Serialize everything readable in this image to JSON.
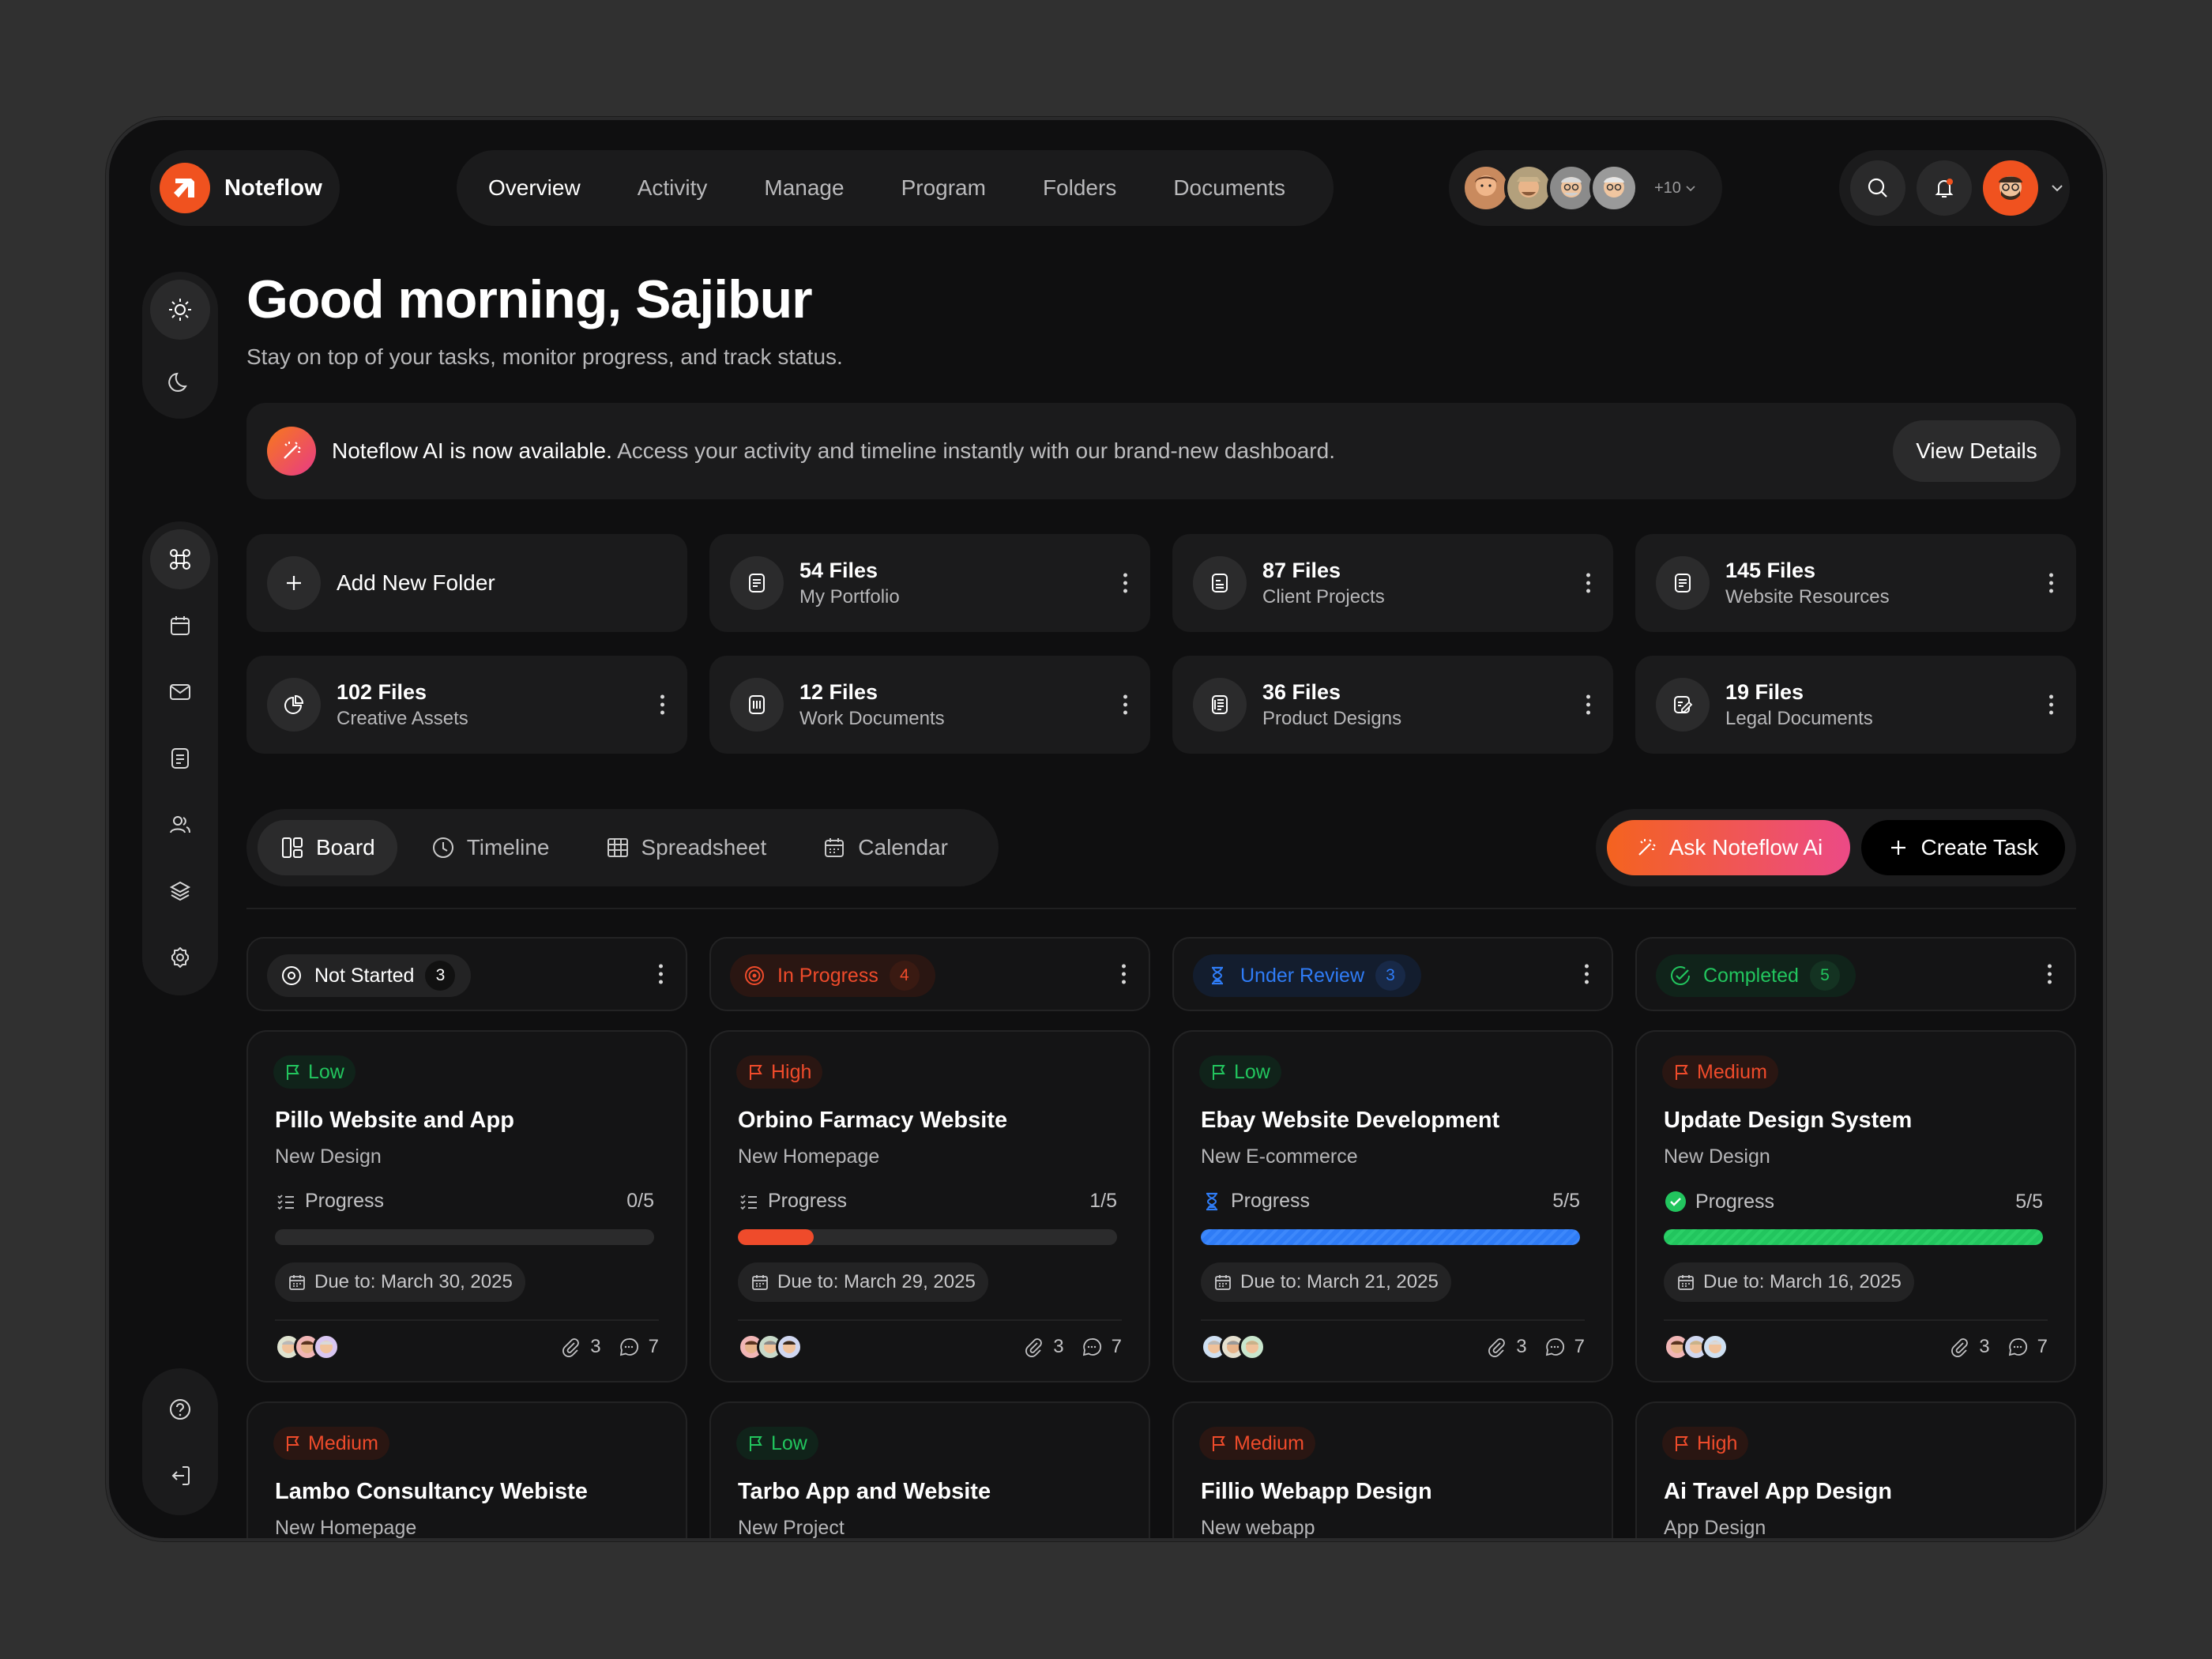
{
  "app": {
    "name": "Noteflow"
  },
  "nav": {
    "items": [
      "Overview",
      "Activity",
      "Manage",
      "Program",
      "Folders",
      "Documents"
    ],
    "active": "Overview"
  },
  "team": {
    "more": "+10"
  },
  "greeting": {
    "title": "Good morning, Sajibur",
    "subtitle": "Stay on top of your tasks, monitor progress, and track status."
  },
  "banner": {
    "strong": "Noteflow AI is now available.",
    "text": " Access your activity and timeline instantly with our brand-new dashboard.",
    "button": "View Details"
  },
  "folders": {
    "add_label": "Add New Folder",
    "items": [
      {
        "count": "54 Files",
        "name": "My Portfolio",
        "icon": "document-icon"
      },
      {
        "count": "87 Files",
        "name": "Client Projects",
        "icon": "document-icon"
      },
      {
        "count": "145 Files",
        "name": "Website Resources",
        "icon": "document-icon"
      },
      {
        "count": "102 Files",
        "name": "Creative Assets",
        "icon": "pie-chart-icon"
      },
      {
        "count": "12 Files",
        "name": "Work Documents",
        "icon": "document-icon"
      },
      {
        "count": "36 Files",
        "name": "Product Designs",
        "icon": "document-icon"
      },
      {
        "count": "19 Files",
        "name": "Legal Documents",
        "icon": "edit-document-icon"
      }
    ]
  },
  "views": {
    "items": [
      "Board",
      "Timeline",
      "Spreadsheet",
      "Calendar"
    ],
    "active": "Board"
  },
  "actions": {
    "ask": "Ask Noteflow Ai",
    "create": "Create Task"
  },
  "columns": [
    {
      "status": "Not Started",
      "count": "3",
      "color": "#d9d9d9"
    },
    {
      "status": "In Progress",
      "count": "4",
      "color": "#ef4b2b"
    },
    {
      "status": "Under Review",
      "count": "3",
      "color": "#2f7cf6"
    },
    {
      "status": "Completed",
      "count": "5",
      "color": "#22c55e"
    }
  ],
  "cards": [
    {
      "priority": "Low",
      "title": "Pillo Website and App",
      "subtitle": "New Design",
      "progress_label": "Progress",
      "progress_text": "0/5",
      "progress": 0.0,
      "due": "Due to: March 30, 2025",
      "attachments": "3",
      "comments": "7"
    },
    {
      "priority": "High",
      "title": "Orbino Farmacy Website",
      "subtitle": "New Homepage",
      "progress_label": "Progress",
      "progress_text": "1/5",
      "progress": 0.2,
      "due": "Due to: March 29, 2025",
      "attachments": "3",
      "comments": "7"
    },
    {
      "priority": "Low",
      "title": "Ebay Website Development",
      "subtitle": "New E-commerce",
      "progress_label": "Progress",
      "progress_text": "5/5",
      "progress": 1.0,
      "due": "Due to: March 21, 2025",
      "attachments": "3",
      "comments": "7"
    },
    {
      "priority": "Medium",
      "title": "Update Design System",
      "subtitle": "New Design",
      "progress_label": "Progress",
      "progress_text": "5/5",
      "progress": 1.0,
      "due": "Due to: March 16, 2025",
      "attachments": "3",
      "comments": "7"
    },
    {
      "priority": "Medium",
      "title": "Lambo Consultancy Webiste",
      "subtitle": "New Homepage"
    },
    {
      "priority": "Low",
      "title": "Tarbo App and Website",
      "subtitle": "New Project"
    },
    {
      "priority": "Medium",
      "title": "Fillio Webapp Design",
      "subtitle": "New webapp"
    },
    {
      "priority": "High",
      "title": "Ai Travel App Design",
      "subtitle": "App Design"
    }
  ],
  "colors": {
    "accent": "#f0521f",
    "low": "#22c55e",
    "medium": "#ef4b2b",
    "high": "#ef4b2b",
    "review": "#2f7cf6"
  }
}
